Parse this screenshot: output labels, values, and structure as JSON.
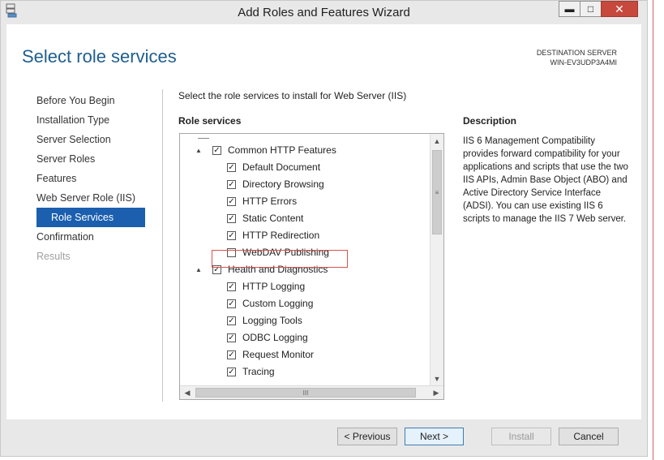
{
  "window": {
    "title": "Add Roles and Features Wizard"
  },
  "page": {
    "title": "Select role services"
  },
  "destination": {
    "label": "DESTINATION SERVER",
    "server": "WIN-EV3UDP3A4MI"
  },
  "nav": [
    {
      "label": "Before You Begin"
    },
    {
      "label": "Installation Type"
    },
    {
      "label": "Server Selection"
    },
    {
      "label": "Server Roles"
    },
    {
      "label": "Features"
    },
    {
      "label": "Web Server Role (IIS)"
    },
    {
      "label": "Role Services"
    },
    {
      "label": "Confirmation"
    },
    {
      "label": "Results"
    }
  ],
  "content": {
    "instruction": "Select the role services to install for Web Server (IIS)",
    "role_services_label": "Role services",
    "tree": [
      {
        "label": "Common HTTP Features",
        "checked": true,
        "parent": true
      },
      {
        "label": "Default Document",
        "checked": true
      },
      {
        "label": "Directory Browsing",
        "checked": true
      },
      {
        "label": "HTTP Errors",
        "checked": true
      },
      {
        "label": "Static Content",
        "checked": true
      },
      {
        "label": "HTTP Redirection",
        "checked": true
      },
      {
        "label": "WebDAV Publishing",
        "checked": false
      },
      {
        "label": "Health and Diagnostics",
        "checked": true,
        "parent": true
      },
      {
        "label": "HTTP Logging",
        "checked": true
      },
      {
        "label": "Custom Logging",
        "checked": true
      },
      {
        "label": "Logging Tools",
        "checked": true
      },
      {
        "label": "ODBC Logging",
        "checked": true
      },
      {
        "label": "Request Monitor",
        "checked": true
      },
      {
        "label": "Tracing",
        "checked": true
      }
    ]
  },
  "description": {
    "label": "Description",
    "text": "IIS 6 Management Compatibility provides forward compatibility for your applications and scripts that use the two IIS APIs, Admin Base Object (ABO) and Active Directory Service Interface (ADSI). You can use existing IIS 6 scripts to manage the IIS 7 Web server."
  },
  "buttons": {
    "previous": "< Previous",
    "next": "Next >",
    "install": "Install",
    "cancel": "Cancel"
  },
  "icons": {
    "expander": "▲",
    "check": "✓",
    "scroll_up": "▲",
    "scroll_down": "▼",
    "scroll_left": "◀",
    "scroll_right": "▶",
    "grip": "≡",
    "hgrip": "III"
  }
}
